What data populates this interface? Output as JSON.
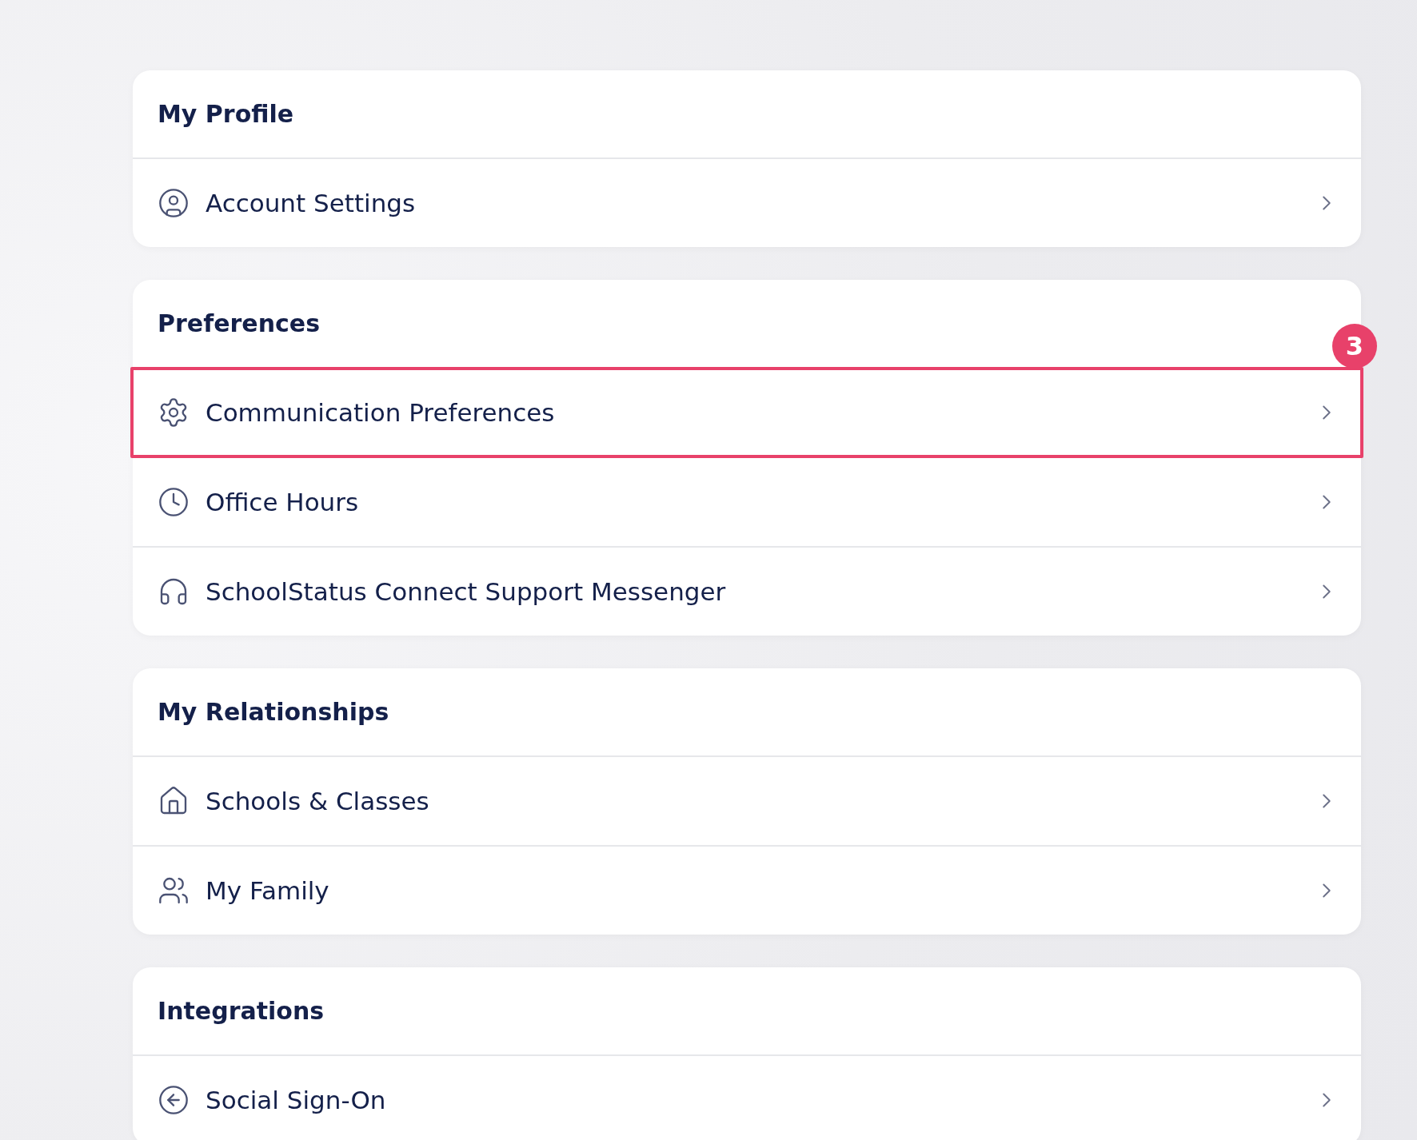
{
  "sections": [
    {
      "title": "My Profile",
      "items": [
        {
          "label": "Account Settings",
          "highlighted": false
        }
      ]
    },
    {
      "title": "Preferences",
      "items": [
        {
          "label": "Communication Preferences",
          "highlighted": true,
          "callout": "3"
        },
        {
          "label": "Office Hours",
          "highlighted": false
        },
        {
          "label": "SchoolStatus Connect Support Messenger",
          "highlighted": false
        }
      ]
    },
    {
      "title": "My Relationships",
      "items": [
        {
          "label": "Schools & Classes",
          "highlighted": false
        },
        {
          "label": "My Family",
          "highlighted": false
        }
      ]
    },
    {
      "title": "Integrations",
      "items": [
        {
          "label": "Social Sign-On",
          "highlighted": false
        }
      ]
    }
  ]
}
